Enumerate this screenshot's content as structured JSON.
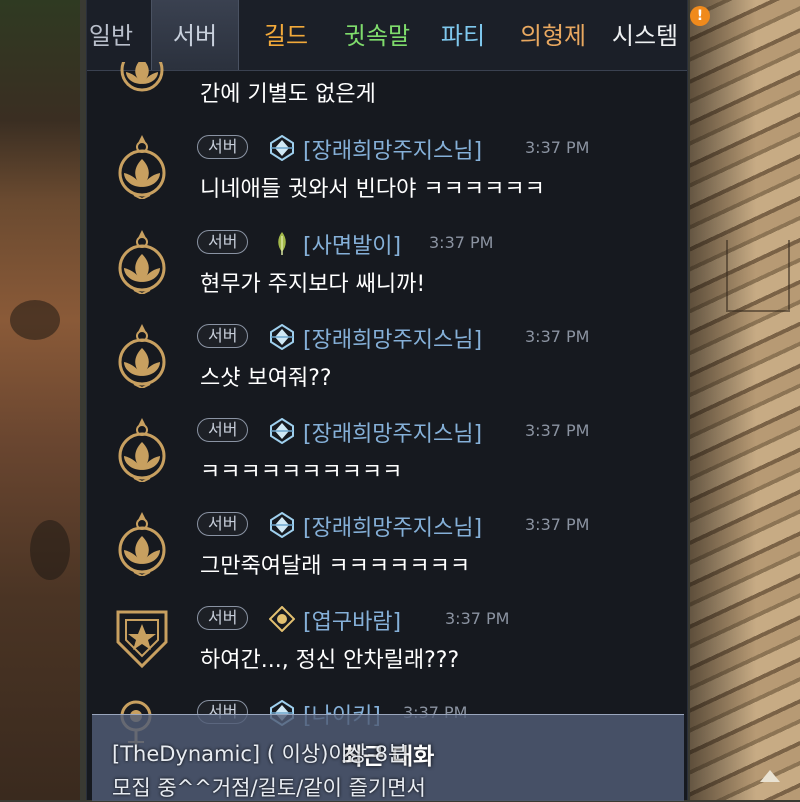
{
  "tabs": [
    {
      "label": "일반",
      "color": "#b9bfcb",
      "active": false
    },
    {
      "label": "서버",
      "color": "#c9d1dd",
      "active": true
    },
    {
      "label": "길드",
      "color": "#f2a93a",
      "active": false
    },
    {
      "label": "귓속말",
      "color": "#7fdc6c",
      "active": false
    },
    {
      "label": "파티",
      "color": "#7fc8ee",
      "active": false
    },
    {
      "label": "의형제",
      "color": "#e9a860",
      "active": false
    },
    {
      "label": "시스템",
      "color": "#eef0f2",
      "active": false
    }
  ],
  "system_notification": "!",
  "partial_message": "간에 기별도 없은게",
  "messages": [
    {
      "channel": "서버",
      "name": "[장래희망주지스님]",
      "time": "3:37 PM",
      "text": "니네애들 귓와서 빈다야 ㅋㅋㅋㅋㅋㅋ",
      "avatar": "lotus-emblem-icon",
      "class_icon": "crest-icon"
    },
    {
      "channel": "서버",
      "name": "[사면발이]",
      "time": "3:37 PM",
      "text": "현무가 주지보다 쌔니까!",
      "avatar": "lotus-emblem-icon",
      "class_icon": "feather-icon"
    },
    {
      "channel": "서버",
      "name": "[장래희망주지스님]",
      "time": "3:37 PM",
      "text": "스샷 보여줘??",
      "avatar": "lotus-emblem-icon",
      "class_icon": "crest-icon"
    },
    {
      "channel": "서버",
      "name": "[장래희망주지스님]",
      "time": "3:37 PM",
      "text": "ㅋㅋㅋㅋㅋㅋㅋㅋㅋㅋ",
      "avatar": "lotus-emblem-icon",
      "class_icon": "crest-icon"
    },
    {
      "channel": "서버",
      "name": "[장래희망주지스님]",
      "time": "3:37 PM",
      "text": "그만죽여달래 ㅋㅋㅋㅋㅋㅋㅋ",
      "avatar": "lotus-emblem-icon",
      "class_icon": "crest-icon"
    },
    {
      "channel": "서버",
      "name": "[엽구바람]",
      "time": "3:37 PM",
      "text": "하여간..., 정신 안차릴래???",
      "avatar": "shield-emblem-icon",
      "class_icon": "diamond-crest-icon"
    },
    {
      "channel": "서버",
      "name": "[나이키]",
      "time": "3:37 PM",
      "text": "",
      "avatar": "staff-emblem-icon",
      "class_icon": "crest-icon"
    }
  ],
  "recent_chat_label": "최근 대화",
  "preview_lines": [
    "[TheDynamic] (      이상)이상-8분",
    "모집 중^^거점/길토/같이 즐기면서"
  ],
  "colors": {
    "panel_bg": "#14171e",
    "name": "#85b0d8",
    "time": "#8b93a1",
    "text": "#ffffff",
    "emblem_gold": "#c8a060"
  }
}
